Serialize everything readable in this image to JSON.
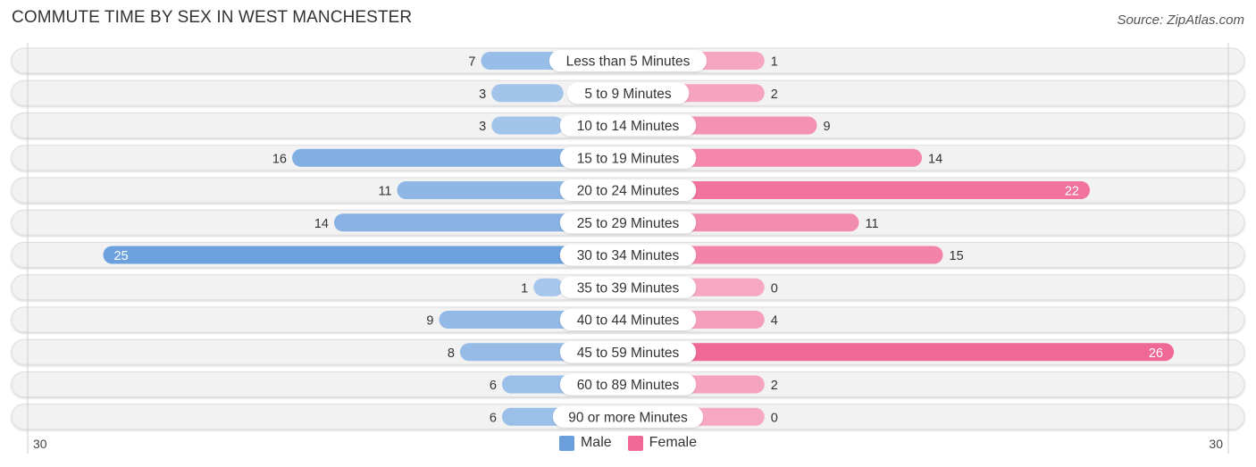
{
  "header": {
    "title": "COMMUTE TIME BY SEX IN WEST MANCHESTER",
    "source": "Source: ZipAtlas.com"
  },
  "colors": {
    "male": "#6a9fdc",
    "male_light": "#a9c8ec",
    "female": "#f06896",
    "female_light": "#f6a8c2",
    "row_bg": "#f2f2f2",
    "label_bg": "#ffffff",
    "text": "#333333"
  },
  "chart_data": {
    "type": "bar",
    "orientation": "horizontal-diverging",
    "title": "COMMUTE TIME BY SEX IN WEST MANCHESTER",
    "categories": [
      "Less than 5 Minutes",
      "5 to 9 Minutes",
      "10 to 14 Minutes",
      "15 to 19 Minutes",
      "20 to 24 Minutes",
      "25 to 29 Minutes",
      "30 to 34 Minutes",
      "35 to 39 Minutes",
      "40 to 44 Minutes",
      "45 to 59 Minutes",
      "60 to 89 Minutes",
      "90 or more Minutes"
    ],
    "series": [
      {
        "name": "Male",
        "side": "left",
        "values": [
          7,
          3,
          3,
          16,
          11,
          14,
          25,
          1,
          9,
          8,
          6,
          6
        ]
      },
      {
        "name": "Female",
        "side": "right",
        "values": [
          1,
          2,
          9,
          14,
          22,
          11,
          15,
          0,
          4,
          26,
          2,
          0
        ]
      }
    ],
    "axis": {
      "min_label": "30",
      "max_label": "30",
      "range": [
        -30,
        30
      ]
    },
    "legend": {
      "position": "bottom-center",
      "entries": [
        "Male",
        "Female"
      ]
    },
    "grid": false
  }
}
